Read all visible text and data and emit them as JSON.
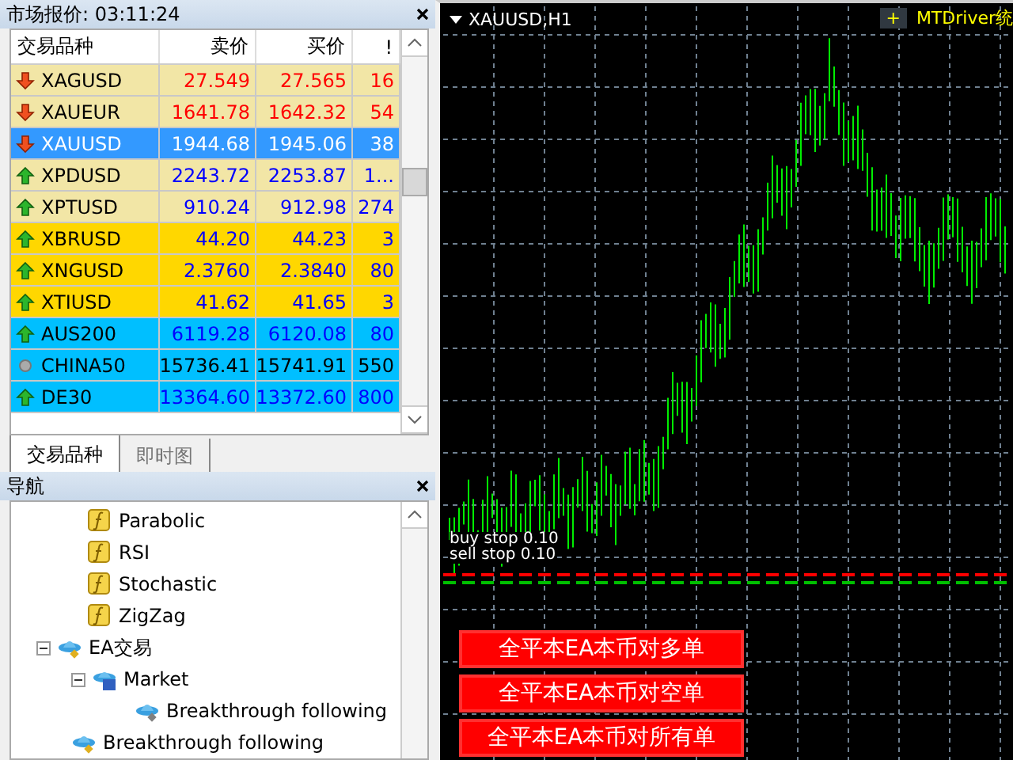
{
  "market_watch": {
    "title": "市场报价: 03:11:24",
    "columns": [
      "交易品种",
      "卖价",
      "买价",
      "!"
    ],
    "rows": [
      {
        "symbol": "XAGUSD",
        "bid": "27.549",
        "ask": "27.565",
        "spread": "16",
        "kind": "down",
        "color": "#f2e6a6",
        "selected": false
      },
      {
        "symbol": "XAUEUR",
        "bid": "1641.78",
        "ask": "1642.32",
        "spread": "54",
        "kind": "down",
        "color": "#f2e6a6",
        "selected": false
      },
      {
        "symbol": "XAUUSD",
        "bid": "1944.68",
        "ask": "1945.06",
        "spread": "38",
        "kind": "down",
        "selected": true
      },
      {
        "symbol": "XPDUSD",
        "bid": "2243.72",
        "ask": "2253.87",
        "spread": "1...",
        "kind": "up",
        "color": "#f2e6a6",
        "selected": false
      },
      {
        "symbol": "XPTUSD",
        "bid": "910.24",
        "ask": "912.98",
        "spread": "274",
        "kind": "up",
        "color": "#f2e6a6",
        "selected": false
      },
      {
        "symbol": "XBRUSD",
        "bid": "44.20",
        "ask": "44.23",
        "spread": "3",
        "kind": "up",
        "color": "#ffd700",
        "selected": false
      },
      {
        "symbol": "XNGUSD",
        "bid": "2.3760",
        "ask": "2.3840",
        "spread": "80",
        "kind": "up",
        "color": "#ffd700",
        "selected": false
      },
      {
        "symbol": "XTIUSD",
        "bid": "41.62",
        "ask": "41.65",
        "spread": "3",
        "kind": "up",
        "color": "#ffd700",
        "selected": false
      },
      {
        "symbol": "AUS200",
        "bid": "6119.28",
        "ask": "6120.08",
        "spread": "80",
        "kind": "up",
        "color": "#00bfff",
        "selected": false
      },
      {
        "symbol": "CHINA50",
        "bid": "15736.41",
        "ask": "15741.91",
        "spread": "550",
        "kind": "none",
        "color": "#00bfff",
        "selected": false
      },
      {
        "symbol": "DE30",
        "bid": "13364.60",
        "ask": "13372.60",
        "spread": "800",
        "kind": "up",
        "color": "#00bfff",
        "selected": false
      }
    ],
    "tabs": [
      {
        "label": "交易品种",
        "selected": true
      },
      {
        "label": "即时图",
        "selected": false
      }
    ]
  },
  "navigator": {
    "title": "导航",
    "items": [
      {
        "label": "Parabolic",
        "kind": "indicator"
      },
      {
        "label": "RSI",
        "kind": "indicator"
      },
      {
        "label": "Stochastic",
        "kind": "indicator"
      },
      {
        "label": "ZigZag",
        "kind": "indicator"
      },
      {
        "label": "EA交易",
        "kind": "folder",
        "expanded": true,
        "children": [
          {
            "label": "Market",
            "kind": "market",
            "expanded": true,
            "children": [
              {
                "label": "Breakthrough following",
                "kind": "ea"
              }
            ]
          },
          {
            "label": "Breakthrough following",
            "kind": "ea"
          }
        ]
      }
    ]
  },
  "chart": {
    "title": "XAUUSD,H1",
    "plus": "+",
    "banner": "MTDriver统",
    "orders": [
      "buy stop 0.10",
      "sell stop 0.10"
    ],
    "buttons": [
      "全平本EA本币对多单",
      "全平本EA本币对空单",
      "全平本EA本币对所有单"
    ]
  }
}
